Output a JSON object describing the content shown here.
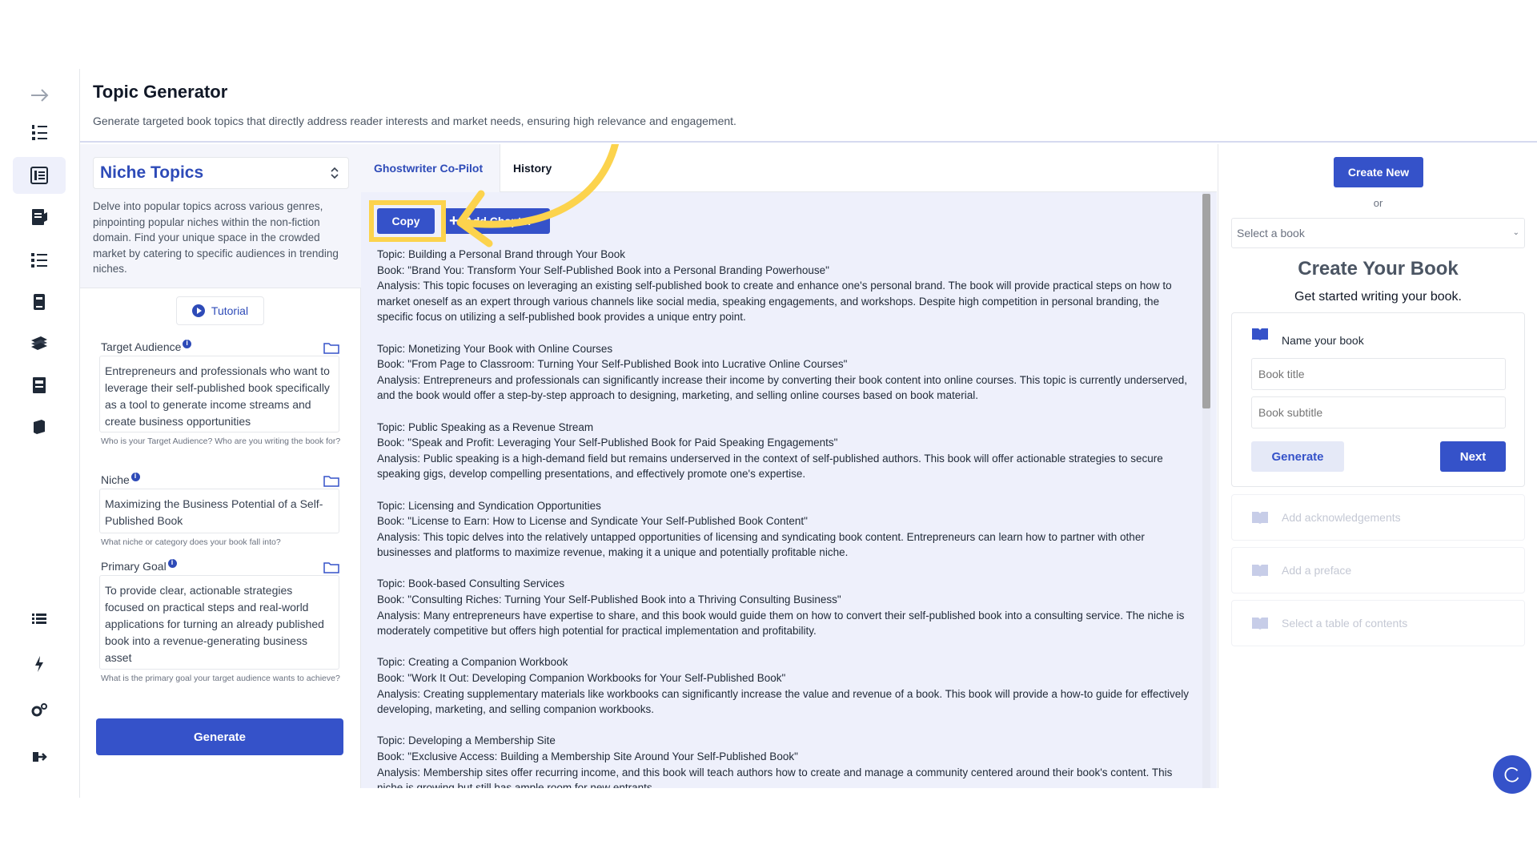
{
  "header": {
    "title": "Topic Generator",
    "subtitle": "Generate targeted book topics that directly address reader interests and market needs, ensuring high relevance and engagement."
  },
  "rail": {
    "icons": [
      "arrow-right-icon",
      "numbered-list-icon",
      "book-outline-icon",
      "notebook-pen-icon",
      "checklist-icon",
      "book-stack-icon",
      "books-icon",
      "archive-icon",
      "book-closed-icon",
      "list-icon",
      "lightning-icon",
      "settings-icon",
      "logout-icon"
    ],
    "active_icon": "book-outline-icon"
  },
  "left_panel": {
    "niche_select": "Niche Topics",
    "description": "Delve into popular topics across various genres, pinpointing popular niches within the non-fiction domain. Find your unique space in the crowded market by catering to specific audiences in trending niches.",
    "tutorial_label": "Tutorial",
    "fields": [
      {
        "label": "Target Audience",
        "value": "Entrepreneurs and professionals who want to leverage their self-published book specifically as a tool to generate income streams and create business opportunities",
        "hint": "Who is your Target Audience? Who are you writing the book for?"
      },
      {
        "label": "Niche",
        "value": "Maximizing the Business Potential of a Self-Published Book",
        "hint": "What niche or category does your book fall into?"
      },
      {
        "label": "Primary Goal",
        "value": "To provide clear, actionable strategies focused on practical steps and real-world applications for turning an already published book into a revenue-generating business asset",
        "hint": "What is the primary goal your target audience wants to achieve?"
      }
    ],
    "generate_label": "Generate"
  },
  "center": {
    "tabs": [
      {
        "label": "Ghostwriter Co-Pilot",
        "active": true
      },
      {
        "label": "History",
        "active": false
      }
    ],
    "copy_label": "Copy",
    "add_label": "Add Chapter",
    "results": [
      {
        "topic": "Topic: Building a Personal Brand through Your Book",
        "book": "Book: \"Brand You: Transform Your Self-Published Book into a Personal Branding Powerhouse\"",
        "analysis": "Analysis: This topic focuses on leveraging an existing self-published book to create and enhance one's personal brand. The book will provide practical steps on how to market oneself as an expert through various channels like social media, speaking engagements, and workshops. Despite high competition in personal branding, the specific focus on utilizing a self-published book provides a unique entry point."
      },
      {
        "topic": "Topic: Monetizing Your Book with Online Courses",
        "book": "Book: \"From Page to Classroom: Turning Your Self-Published Book into Lucrative Online Courses\"",
        "analysis": "Analysis: Entrepreneurs and professionals can significantly increase their income by converting their book content into online courses. This topic is currently underserved, and the book would offer a step-by-step approach to designing, marketing, and selling online courses based on book material."
      },
      {
        "topic": "Topic: Public Speaking as a Revenue Stream",
        "book": "Book: \"Speak and Profit: Leveraging Your Self-Published Book for Paid Speaking Engagements\"",
        "analysis": "Analysis: Public speaking is a high-demand field but remains underserved in the context of self-published authors. This book will offer actionable strategies to secure speaking gigs, develop compelling presentations, and effectively promote one's expertise."
      },
      {
        "topic": "Topic: Licensing and Syndication Opportunities",
        "book": "Book: \"License to Earn: How to License and Syndicate Your Self-Published Book Content\"",
        "analysis": "Analysis: This topic delves into the relatively untapped opportunities of licensing and syndicating book content. Entrepreneurs can learn how to partner with other businesses and platforms to maximize revenue, making it a unique and potentially profitable niche."
      },
      {
        "topic": "Topic: Book-based Consulting Services",
        "book": "Book: \"Consulting Riches: Turning Your Self-Published Book into a Thriving Consulting Business\"",
        "analysis": "Analysis: Many entrepreneurs have expertise to share, and this book would guide them on how to convert their self-published book into a consulting service. The niche is moderately competitive but offers high potential for practical implementation and profitability."
      },
      {
        "topic": "Topic: Creating a Companion Workbook",
        "book": "Book: \"Work It Out: Developing Companion Workbooks for Your Self-Published Book\"",
        "analysis": "Analysis: Creating supplementary materials like workbooks can significantly increase the value and revenue of a book. This book will provide a how-to guide for effectively developing, marketing, and selling companion workbooks."
      },
      {
        "topic": "Topic: Developing a Membership Site",
        "book": "Book: \"Exclusive Access: Building a Membership Site Around Your Self-Published Book\"",
        "analysis": "Analysis: Membership sites offer recurring income, and this book will teach authors how to create and manage a community centered around their book's content. This niche is growing but still has ample room for new entrants."
      }
    ]
  },
  "right_panel": {
    "create_new_label": "Create New",
    "or_text": "or",
    "select_book_placeholder": "Select a book",
    "create_title": "Create Your Book",
    "create_subtitle": "Get started writing your book.",
    "name_heading": "Name your book",
    "book_title_placeholder": "Book title",
    "book_subtitle_placeholder": "Book subtitle",
    "generate_label": "Generate",
    "next_label": "Next",
    "steps": [
      "Add acknowledgements",
      "Add a preface",
      "Select a table of contents"
    ]
  },
  "colors": {
    "accent": "#3552c9",
    "highlight": "#fcd34d",
    "panel_bg": "#eef0fb"
  }
}
